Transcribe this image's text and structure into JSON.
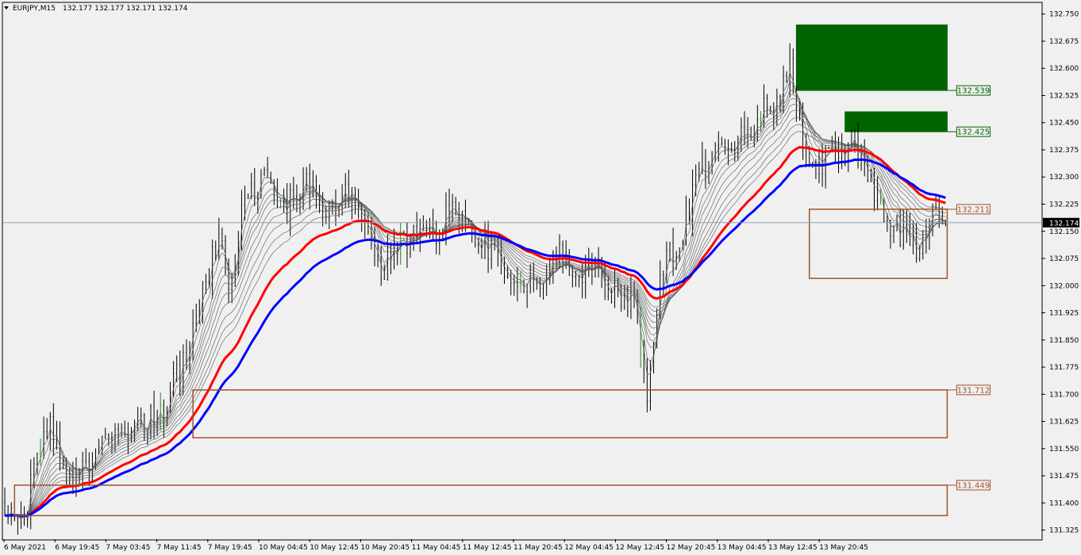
{
  "header": {
    "symbol": "EURJPY,M15",
    "ohlc": "132.177 132.177 132.171 132.174"
  },
  "chart_data": {
    "type": "candlestick",
    "title": "EURJPY,M15",
    "ylim": [
      131.3,
      132.78
    ],
    "y_ticks": [
      "132.750",
      "132.675",
      "132.600",
      "132.525",
      "132.450",
      "132.375",
      "132.300",
      "132.225",
      "132.150",
      "132.075",
      "132.000",
      "131.925",
      "131.850",
      "131.775",
      "131.700",
      "131.625",
      "131.550",
      "131.475",
      "131.400",
      "131.325"
    ],
    "x_ticks": [
      "6 May 2021",
      "6 May 19:45",
      "7 May 03:45",
      "7 May 11:45",
      "7 May 19:45",
      "10 May 04:45",
      "10 May 12:45",
      "10 May 20:45",
      "11 May 04:45",
      "11 May 12:45",
      "11 May 20:45",
      "12 May 04:45",
      "12 May 12:45",
      "12 May 20:45",
      "13 May 04:45",
      "13 May 12:45",
      "13 May 20:45"
    ],
    "current_price": "132.174",
    "current_price_value": 132.174,
    "close_path": [
      [
        0,
        131.4
      ],
      [
        6,
        131.35
      ],
      [
        10,
        131.55
      ],
      [
        14,
        131.62
      ],
      [
        18,
        131.5
      ],
      [
        24,
        131.48
      ],
      [
        30,
        131.55
      ],
      [
        36,
        131.58
      ],
      [
        42,
        131.6
      ],
      [
        50,
        131.66
      ],
      [
        56,
        131.82
      ],
      [
        62,
        132.02
      ],
      [
        66,
        132.12
      ],
      [
        70,
        132.0
      ],
      [
        74,
        132.25
      ],
      [
        80,
        132.28
      ],
      [
        86,
        132.2
      ],
      [
        92,
        132.28
      ],
      [
        100,
        132.22
      ],
      [
        106,
        132.24
      ],
      [
        112,
        132.18
      ],
      [
        116,
        132.05
      ],
      [
        122,
        132.12
      ],
      [
        130,
        132.14
      ],
      [
        136,
        132.18
      ],
      [
        142,
        132.2
      ],
      [
        146,
        132.12
      ],
      [
        152,
        132.08
      ],
      [
        158,
        132.02
      ],
      [
        164,
        132.0
      ],
      [
        170,
        132.08
      ],
      [
        176,
        132.02
      ],
      [
        182,
        132.04
      ],
      [
        188,
        131.98
      ],
      [
        194,
        131.96
      ],
      [
        198,
        131.72
      ],
      [
        202,
        132.04
      ],
      [
        208,
        132.12
      ],
      [
        214,
        132.32
      ],
      [
        220,
        132.38
      ],
      [
        226,
        132.4
      ],
      [
        232,
        132.46
      ],
      [
        238,
        132.5
      ],
      [
        242,
        132.62
      ],
      [
        246,
        132.4
      ],
      [
        250,
        132.3
      ],
      [
        256,
        132.38
      ],
      [
        262,
        132.4
      ],
      [
        266,
        132.3
      ],
      [
        270,
        132.2
      ],
      [
        276,
        132.14
      ],
      [
        282,
        132.08
      ],
      [
        286,
        132.2
      ],
      [
        290,
        132.17
      ]
    ],
    "zones": [
      {
        "label": "132.539",
        "top": 132.72,
        "bottom": 132.539,
        "start": 244,
        "kind": "supply"
      },
      {
        "label": "132.425",
        "top": 132.48,
        "bottom": 132.425,
        "start": 259,
        "kind": "supply"
      },
      {
        "label": "132.211",
        "top": 132.211,
        "bottom": 132.02,
        "start": 248,
        "kind": "demand"
      },
      {
        "label": "131.712",
        "top": 131.712,
        "bottom": 131.58,
        "start": 58,
        "kind": "demand"
      },
      {
        "label": "131.449",
        "top": 131.449,
        "bottom": 131.365,
        "start": 3,
        "kind": "demand"
      }
    ],
    "ma_ribbon_count": 10,
    "grid": false,
    "colors": {
      "background": "#f0f0f0",
      "candles": "#000000",
      "ma_red": "#ff0000",
      "ma_blue": "#0000ff",
      "ma_thin": "#555555",
      "supply_zone": "#006400",
      "demand_zone": "#a0522d",
      "price_line": "#8fa3b8",
      "price_label_bg": "#000000",
      "price_label_fg": "#ffffff"
    }
  }
}
